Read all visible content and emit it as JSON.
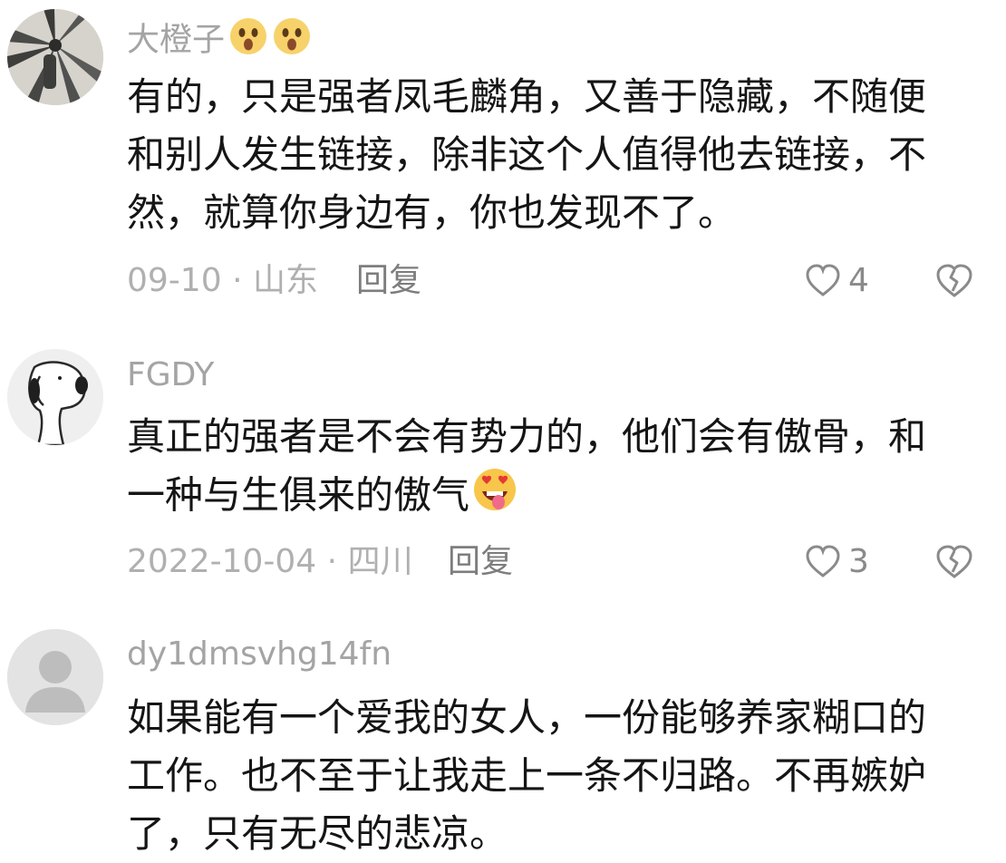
{
  "comments": [
    {
      "username": "大橙子",
      "username_emojis": [
        "astonished-face-emoji",
        "astonished-face-emoji"
      ],
      "lines": [
        "有的，只是强者凤毛麟角，又善于隐藏，不随便",
        "和别人发生链接，除非这个人值得他去链接，不",
        "然，就算你身边有，你也发现不了。"
      ],
      "date": "09-10",
      "separator": "·",
      "location": "山东",
      "reply_label": "回复",
      "likes": "4"
    },
    {
      "username": "FGDY",
      "lines": [
        "真正的强者是不会有势力的，他们会有傲骨，和",
        "一种与生俱来的傲气"
      ],
      "trailing_emoji": "heart-eyes-tongue-emoji",
      "date": "2022-10-04",
      "separator": "·",
      "location": "四川",
      "reply_label": "回复",
      "likes": "3"
    },
    {
      "username": "dy1dmsvhg14fn",
      "lines": [
        "如果能有一个爱我的女人，一份能够养家糊口的",
        "工作。也不至于让我走上一条不归路。不再嫉妒",
        "了，只有无尽的悲凉。"
      ]
    }
  ],
  "colors": {
    "username": "#a4a4a4",
    "text": "#151515",
    "meta": "#b0b0b0",
    "reply": "#7d7d7d",
    "icon": "#8a8a8a"
  }
}
